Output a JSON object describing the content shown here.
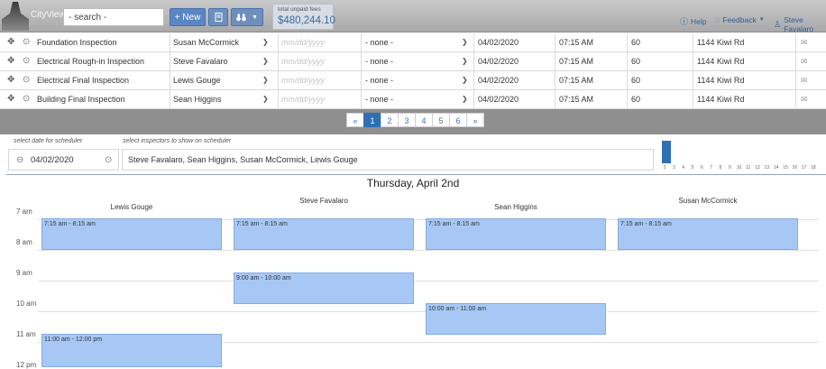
{
  "header": {
    "app_name": "CityView",
    "search_value": "- search -",
    "new_label": "+ New",
    "doc_icon": "document-icon",
    "binoculars_icon": "binoculars-icon",
    "fees_label": "total unpaid fees",
    "fees_value": "$480,244.10",
    "help_label": "Help",
    "feedback_label": "Feedback",
    "user_label": "Steve Favalaro"
  },
  "inspections": {
    "rows": [
      {
        "name": "Foundation Inspection",
        "inspector": "Susan McCormick",
        "date_placeholder": "mm/dd/yyyy",
        "result": "- none -",
        "scheduled": "04/02/2020",
        "time": "07:15 AM",
        "duration": "60",
        "address": "1144 Kiwi Rd"
      },
      {
        "name": "Electrical Rough-in Inspection",
        "inspector": "Steve Favalaro",
        "date_placeholder": "mm/dd/yyyy",
        "result": "- none -",
        "scheduled": "04/02/2020",
        "time": "07:15 AM",
        "duration": "60",
        "address": "1144 Kiwi Rd"
      },
      {
        "name": "Electrical Final Inspection",
        "inspector": "Lewis Gouge",
        "date_placeholder": "mm/dd/yyyy",
        "result": "- none -",
        "scheduled": "04/02/2020",
        "time": "07:15 AM",
        "duration": "60",
        "address": "1144 Kiwi Rd"
      },
      {
        "name": "Building Final Inspection",
        "inspector": "Sean Higgins",
        "date_placeholder": "mm/dd/yyyy",
        "result": "- none -",
        "scheduled": "04/02/2020",
        "time": "07:15 AM",
        "duration": "60",
        "address": "1144 Kiwi Rd"
      }
    ]
  },
  "pagination": {
    "prev": "«",
    "pages": [
      "1",
      "2",
      "3",
      "4",
      "5",
      "6"
    ],
    "active_page": "1",
    "next": "»"
  },
  "scheduler": {
    "date_label": "select date for scheduler",
    "date_value": "04/02/2020",
    "inspectors_label": "select inspectors to show on scheduler",
    "inspectors_value": "Steve Favalaro, Sean Higgins, Susan McCormick, Lewis Gouge",
    "histogram_ticks": [
      "2",
      "3",
      "4",
      "5",
      "6",
      "7",
      "8",
      "9",
      "10",
      "11",
      "12",
      "13",
      "14",
      "15",
      "16",
      "17",
      "18"
    ]
  },
  "calendar": {
    "title": "Thursday, April 2nd",
    "hours": [
      "7 am",
      "8 am",
      "9 am",
      "10 am",
      "11 am",
      "12 pm"
    ],
    "columns": [
      "Lewis Gouge",
      "Steve Favalaro",
      "Sean Higgins",
      "Susan McCormick"
    ],
    "events": [
      {
        "column": 0,
        "label": "7:15 am - 8:15 am"
      },
      {
        "column": 1,
        "label": "7:15 am - 8:15 am"
      },
      {
        "column": 2,
        "label": "7:15 am - 8:15 am"
      },
      {
        "column": 3,
        "label": "7:15 am - 8:15 am"
      },
      {
        "column": 1,
        "label": "9:00 am - 10:00 am"
      },
      {
        "column": 2,
        "label": "10:00 am - 11:00 am"
      },
      {
        "column": 0,
        "label": "11:00 am - 12:00 pm"
      }
    ]
  }
}
